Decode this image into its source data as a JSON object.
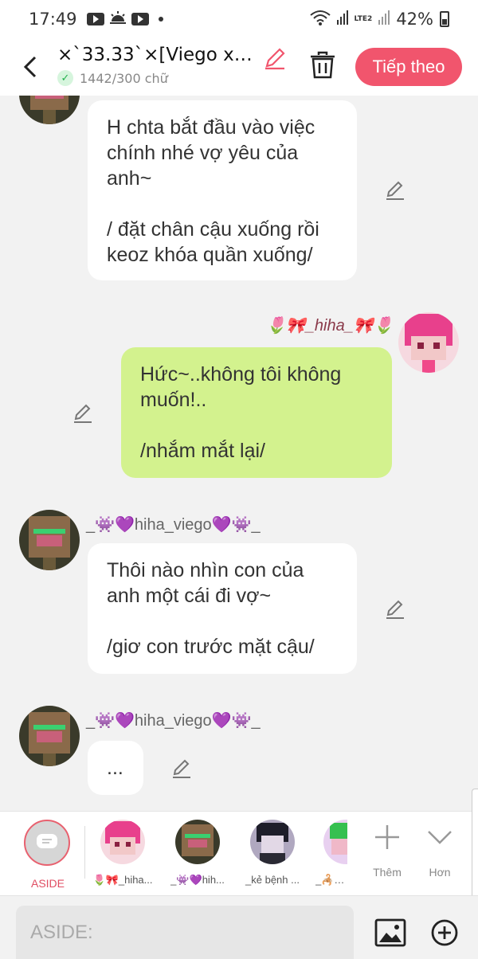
{
  "status_bar": {
    "time": "17:49",
    "network": "LTE2",
    "battery": "42%"
  },
  "header": {
    "title": "×`33.33`×[Viego x h...",
    "word_count": "1442/300 chữ",
    "next_label": "Tiếp theo"
  },
  "messages": [
    {
      "side": "left",
      "username": "",
      "text": "H chta bắt đầu vào việc chính nhé vợ yêu của anh~\n\n/ đặt chân cậu xuống rồi keoz khóa quần xuống/"
    },
    {
      "side": "right",
      "username": "🌷🎀_hiha_🎀🌷",
      "text": "Hức~..không tôi không muốn!..\n\n/nhắm mắt lại/"
    },
    {
      "side": "left",
      "username": "_👾💜hiha_viego💜👾_",
      "text": "Thôi nào nhìn con của anh một cái đi vợ~\n\n/giơ con trước mặt cậu/"
    },
    {
      "side": "left",
      "username": "_👾💜hiha_viego💜👾_",
      "text": "..."
    }
  ],
  "character_bar": {
    "aside_label": "ASIDE",
    "characters": [
      {
        "label": "🌷🎀_hiha..."
      },
      {
        "label": "_👾💜hih..."
      },
      {
        "label": "_kẻ bệnh ..."
      },
      {
        "label": "_🦂🕸..."
      }
    ],
    "add_label": "Thêm",
    "more_label": "Hơn"
  },
  "input": {
    "placeholder": "ASIDE:"
  },
  "colors": {
    "accent": "#f1556d",
    "green_bubble": "#d3f28e",
    "white_bubble": "#ffffff",
    "background": "#f2f2f2"
  }
}
